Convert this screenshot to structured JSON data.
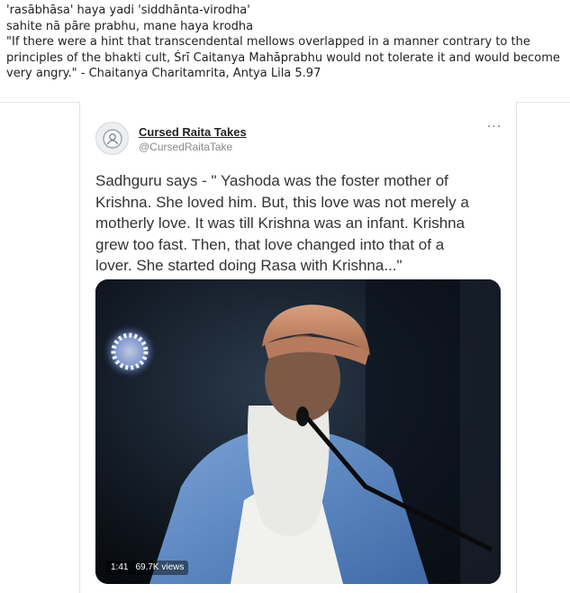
{
  "caption": {
    "lines": [
      "'rasābhāsa' haya yadi 'siddhānta-virodha'",
      "sahite nā pāre prabhu, mane haya krodha",
      "\"If there were a hint that transcendental mellows overlapped in a manner contrary to the",
      "principles of the bhakti cult, Śrī Caitanya Mahāprabhu would not tolerate it and would become",
      "very angry.\" - Chaitanya Charitamrita, Antya Lila 5.97"
    ]
  },
  "tweet": {
    "author_name": "Cursed Raita Takes",
    "author_handle": "@CursedRaitaTake",
    "more_label": "···",
    "text_lines": [
      "Sadhguru says - \" Yashoda was the foster mother of",
      "Krishna. She loved him. But, this love was not merely a",
      "motherly love. It was till Krishna was an infant. Krishna",
      "grew too fast. Then, that love changed into that of a",
      "lover. She started doing Rasa with Krishna...\""
    ],
    "video": {
      "duration": "1:41",
      "views": "69.7K views"
    }
  }
}
